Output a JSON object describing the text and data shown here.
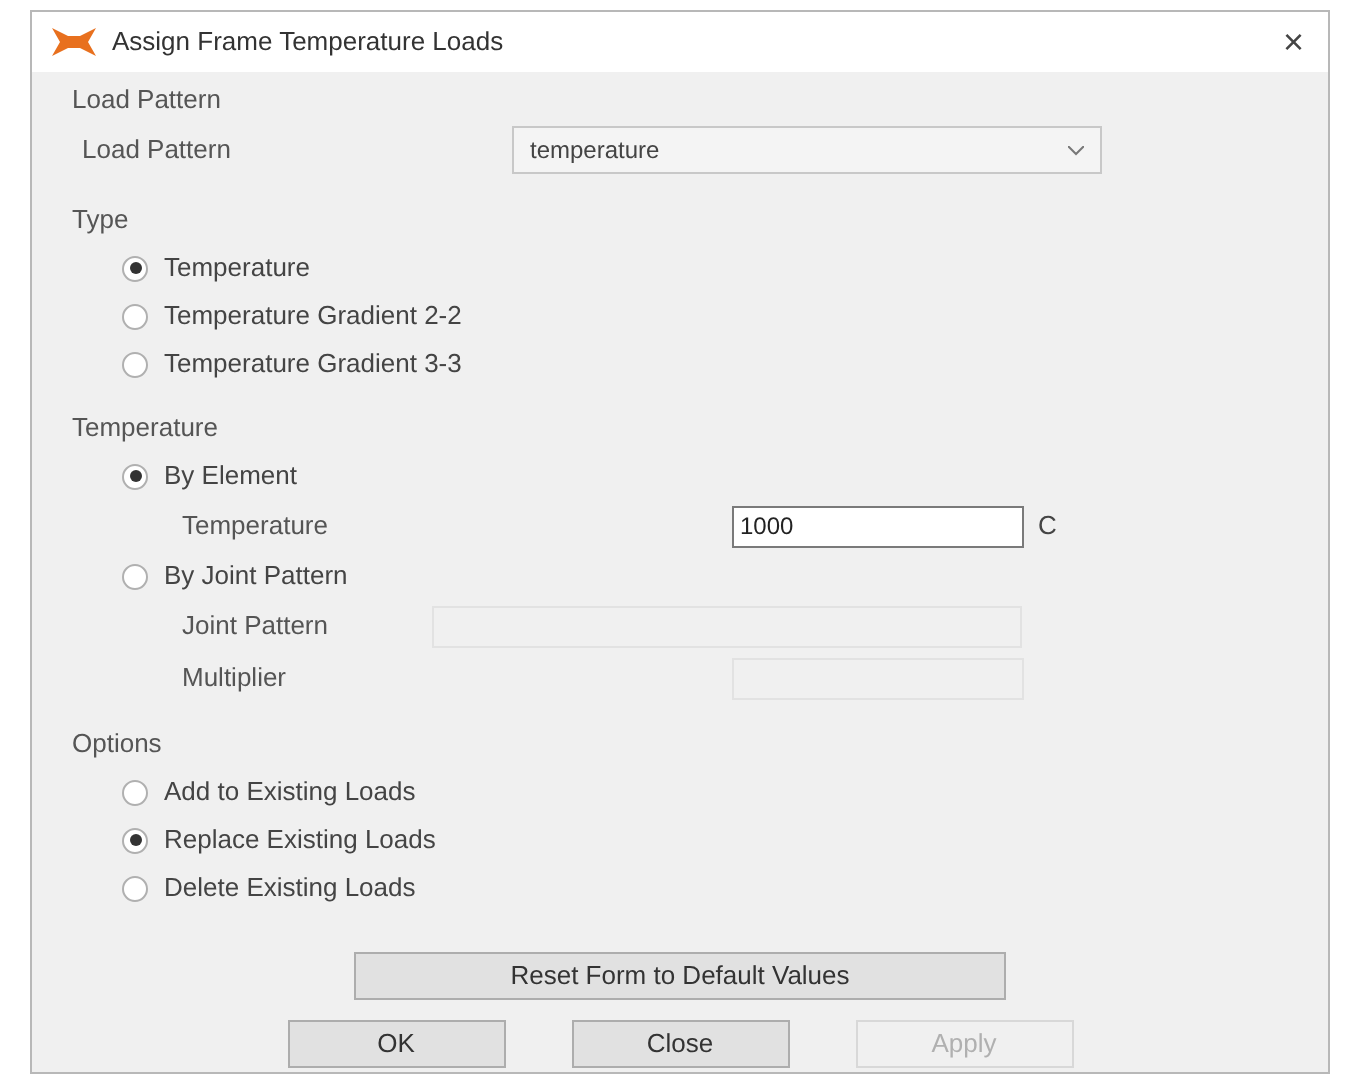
{
  "window": {
    "title": "Assign Frame Temperature Loads",
    "close": "×"
  },
  "load_pattern": {
    "heading": "Load Pattern",
    "label": "Load Pattern",
    "value": "temperature"
  },
  "type": {
    "heading": "Type",
    "options": [
      {
        "label": "Temperature",
        "selected": true
      },
      {
        "label": "Temperature Gradient 2-2",
        "selected": false
      },
      {
        "label": "Temperature Gradient 3-3",
        "selected": false
      }
    ]
  },
  "temperature": {
    "heading": "Temperature",
    "items": [
      {
        "kind": "radio",
        "label": "By Element",
        "selected": true
      },
      {
        "kind": "field",
        "label": "Temperature",
        "value": "1000",
        "unit": "C",
        "disabled": false
      },
      {
        "kind": "radio",
        "label": "By Joint Pattern",
        "selected": false
      },
      {
        "kind": "dropdown",
        "label": "Joint Pattern",
        "disabled": true
      },
      {
        "kind": "field",
        "label": "Multiplier",
        "disabled": true
      }
    ]
  },
  "options": {
    "heading": "Options",
    "options": [
      {
        "label": "Add to Existing Loads",
        "selected": false
      },
      {
        "label": "Replace Existing Loads",
        "selected": true
      },
      {
        "label": "Delete Existing Loads",
        "selected": false
      }
    ]
  },
  "reset_button": "Reset Form to Default Values",
  "buttons": [
    {
      "label": "OK",
      "disabled": false
    },
    {
      "label": "Close",
      "disabled": false
    },
    {
      "label": "Apply",
      "disabled": true
    }
  ]
}
